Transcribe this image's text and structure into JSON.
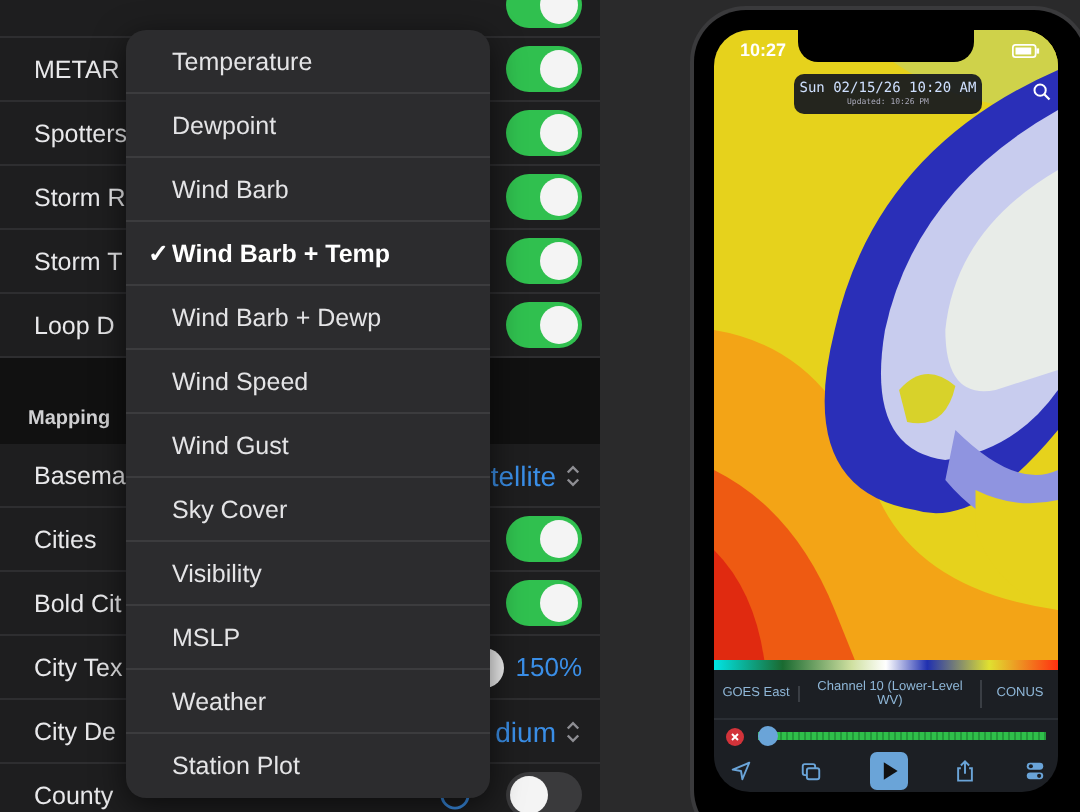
{
  "settings": {
    "groups": [
      {
        "rows": [
          {
            "kind": "toggle",
            "on": true
          },
          {
            "kind": "toggle",
            "label": "METAR",
            "on": true
          },
          {
            "kind": "toggle",
            "label": "Spotters",
            "on": true
          },
          {
            "kind": "toggle",
            "label": "Storm R",
            "on": true
          },
          {
            "kind": "toggle",
            "label": "Storm T",
            "on": true
          },
          {
            "kind": "toggle",
            "label": "Loop D",
            "on": true
          }
        ]
      },
      {
        "header": "Mapping",
        "rows": [
          {
            "kind": "select",
            "label": "Basema",
            "value": "tellite"
          },
          {
            "kind": "toggle",
            "label": "Cities",
            "on": true
          },
          {
            "kind": "toggle",
            "label": "Bold Cit",
            "on": true
          },
          {
            "kind": "slider",
            "label": "City Tex",
            "value": "150%"
          },
          {
            "kind": "select",
            "label": "City De",
            "value": "dium"
          },
          {
            "kind": "toggle_info",
            "label": "County",
            "on": false
          }
        ]
      }
    ]
  },
  "menu": {
    "items": [
      {
        "label": "Temperature",
        "selected": false
      },
      {
        "label": "Dewpoint",
        "selected": false
      },
      {
        "label": "Wind Barb",
        "selected": false
      },
      {
        "label": "Wind Barb + Temp",
        "selected": true
      },
      {
        "label": "Wind Barb + Dewp",
        "selected": false
      },
      {
        "label": "Wind Speed",
        "selected": false
      },
      {
        "label": "Wind Gust",
        "selected": false
      },
      {
        "label": "Sky Cover",
        "selected": false
      },
      {
        "label": "Visibility",
        "selected": false
      },
      {
        "label": "MSLP",
        "selected": false
      },
      {
        "label": "Weather",
        "selected": false
      },
      {
        "label": "Station Plot",
        "selected": false
      }
    ],
    "check": "✓"
  },
  "phone": {
    "status_time": "10:27",
    "overlay": {
      "date": "Sun 02/15/26 10:20 AM",
      "updated": "Updated: 10:26 PM"
    },
    "info_bar": [
      "GOES East",
      "Channel 10 (Lower-Level WV)",
      "CONUS"
    ],
    "timeline": {
      "level": 0.0
    }
  }
}
